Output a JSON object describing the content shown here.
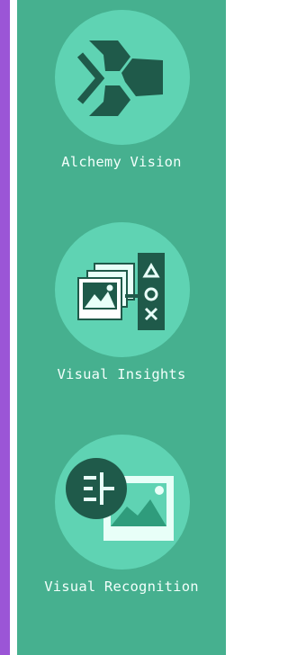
{
  "services": [
    {
      "label": "Alchemy Vision",
      "icon": "alchemy-vision-icon"
    },
    {
      "label": "Visual Insights",
      "icon": "visual-insights-icon"
    },
    {
      "label": "Visual Recognition",
      "icon": "visual-recognition-icon"
    }
  ],
  "colors": {
    "sidebar_accent": "#9b55d6",
    "panel_bg": "#46b08f",
    "circle_bg": "#5fd3b3",
    "icon_dark": "#1f5a4a",
    "label_text": "#f2fffb"
  }
}
